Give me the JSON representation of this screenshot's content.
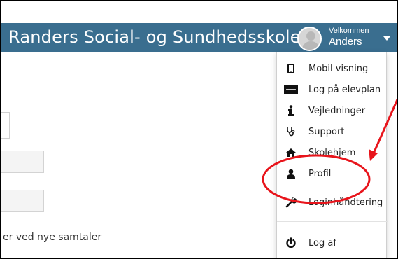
{
  "header": {
    "brand": "Randers Social- og Sundhedsskole",
    "welcome": "Velkommen",
    "username": "Anders"
  },
  "dropdown": {
    "items": [
      {
        "label": "Mobil visning",
        "icon": "mobile-icon"
      },
      {
        "label": "Log på elevplan",
        "icon": "elevplan-logo-icon"
      },
      {
        "label": "Vejledninger",
        "icon": "info-icon"
      },
      {
        "label": "Support",
        "icon": "stethoscope-icon"
      },
      {
        "label": "Skolehjem",
        "icon": "home-icon"
      },
      {
        "label": "Profil",
        "icon": "user-icon"
      },
      {
        "label": "Loginhåndtering",
        "icon": "wrench-icon"
      },
      {
        "label": "Log af",
        "icon": "power-icon"
      }
    ]
  },
  "content": {
    "trailing_text": "er ved nye samtaler"
  },
  "annotation": {
    "color": "#e8141b",
    "target": "Profil"
  },
  "colors": {
    "navbar": "#3a6e8f",
    "accent": "#4aa0e0"
  }
}
